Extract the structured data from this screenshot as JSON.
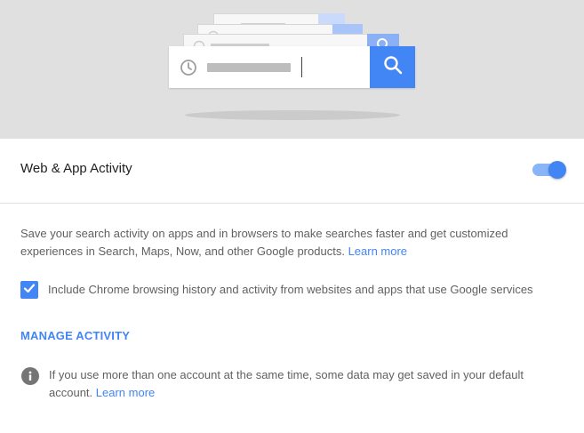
{
  "illustration": {
    "search_icon": "search-icon",
    "clock_icon": "clock-icon",
    "accent": "#4285f4"
  },
  "activity": {
    "title": "Web & App Activity",
    "toggle_on": true,
    "description": "Save your search activity on apps and in browsers to make searches faster and get customized experiences in Search, Maps, Now, and other Google products.",
    "learn_more": "Learn more",
    "checkbox_checked": true,
    "checkbox_label": "Include Chrome browsing history and activity from websites and apps that use Google services",
    "manage_label": "MANAGE ACTIVITY",
    "info_text": "If you use more than one account at the same time, some data may get saved in your default account.",
    "info_learn_more": "Learn more",
    "info_icon": "info-icon"
  },
  "colors": {
    "link": "#4285f4",
    "toggle_track": "#8ab4f8",
    "hero_bg": "#e0e0e0"
  }
}
